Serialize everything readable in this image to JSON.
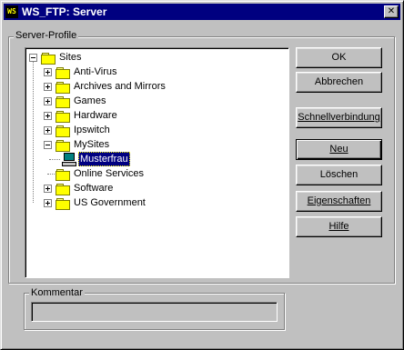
{
  "window": {
    "title": "WS_FTP: Server",
    "close_glyph": "✕",
    "icon": "ws-ftp-icon"
  },
  "server_profile": {
    "group_label": "Server-Profile",
    "tree": [
      {
        "label": "Sites",
        "icon": "folder-icon",
        "expander": "minus",
        "selected": false
      },
      {
        "label": "Anti-Virus",
        "icon": "folder-icon",
        "expander": "plus",
        "selected": false
      },
      {
        "label": "Archives and Mirrors",
        "icon": "folder-icon",
        "expander": "plus",
        "selected": false
      },
      {
        "label": "Games",
        "icon": "folder-icon",
        "expander": "plus",
        "selected": false
      },
      {
        "label": "Hardware",
        "icon": "folder-icon",
        "expander": "plus",
        "selected": false
      },
      {
        "label": "Ipswitch",
        "icon": "folder-icon",
        "expander": "plus",
        "selected": false
      },
      {
        "label": "MySites",
        "icon": "folder-icon",
        "expander": "minus",
        "selected": false
      },
      {
        "label": "Musterfrau",
        "icon": "computer-icon",
        "expander": "none",
        "selected": true
      },
      {
        "label": "Online Services",
        "icon": "folder-icon",
        "expander": "none",
        "selected": false
      },
      {
        "label": "Software",
        "icon": "folder-icon",
        "expander": "plus",
        "selected": false
      },
      {
        "label": "US Government",
        "icon": "folder-icon",
        "expander": "plus",
        "selected": false
      }
    ]
  },
  "buttons": {
    "ok": "OK",
    "cancel": "Abbrechen",
    "quick_connect": "Schnellverbindung",
    "new_label": "Neu",
    "delete_label": "Löschen",
    "properties_label": "Eigenschaften",
    "help_label": "Hilfe"
  },
  "comment": {
    "group_label": "Kommentar",
    "value": ""
  },
  "colors": {
    "face": "#c0c0c0",
    "titlebar": "#000080",
    "selection": "#000080",
    "folder": "#ffff00"
  }
}
